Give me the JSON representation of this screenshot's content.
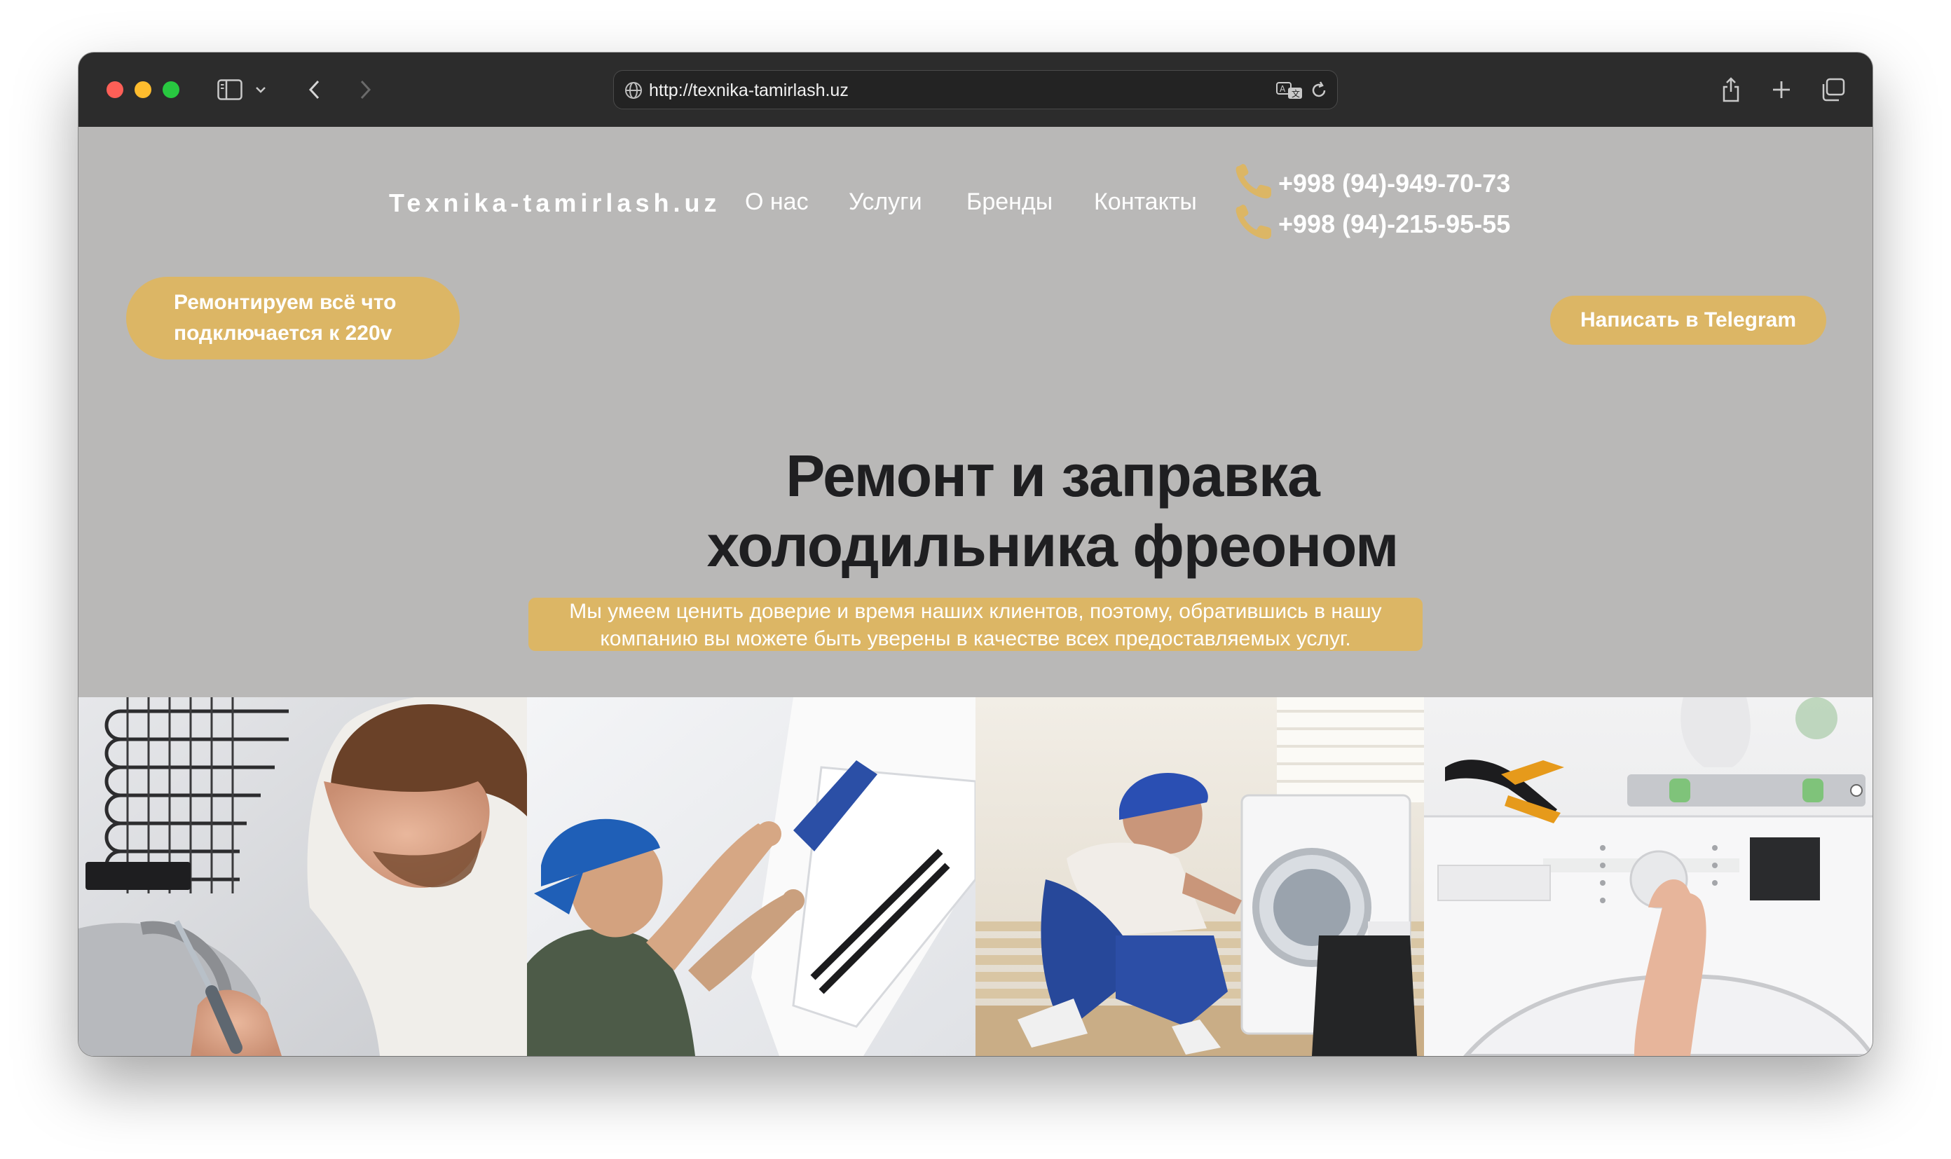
{
  "browser": {
    "url": "http://texnika-tamirlash.uz"
  },
  "header": {
    "logo": "Texnika-tamirlash.uz",
    "nav": [
      "О нас",
      "Услуги",
      "Бренды",
      "Контакты"
    ],
    "phones": [
      "+998 (94)-949-70-73",
      "+998 (94)-215-95-55"
    ]
  },
  "hero": {
    "badge": "Ремонтируем всё что подключается к 220v",
    "telegram_button": "Написать в Telegram",
    "title_line1": "Ремонт и заправка",
    "title_line2": "холодильника фреоном",
    "subtitle_line1": "Мы умеем ценить доверие и время наших клиентов, поэтому, обратившись в нашу",
    "subtitle_line2": "компанию вы можете быть уверены в качестве всех предоставляемых услуг."
  },
  "colors": {
    "accent": "#dcb665",
    "page_background": "#b9b8b7",
    "title": "#1f1f21",
    "chrome": "#2c2c2c"
  },
  "icons": [
    "sidebar-icon",
    "chevron-down-icon",
    "back-icon",
    "forward-icon",
    "globe-icon",
    "translate-icon",
    "reload-icon",
    "share-icon",
    "new-tab-icon",
    "tabs-overview-icon",
    "phone-icon"
  ]
}
